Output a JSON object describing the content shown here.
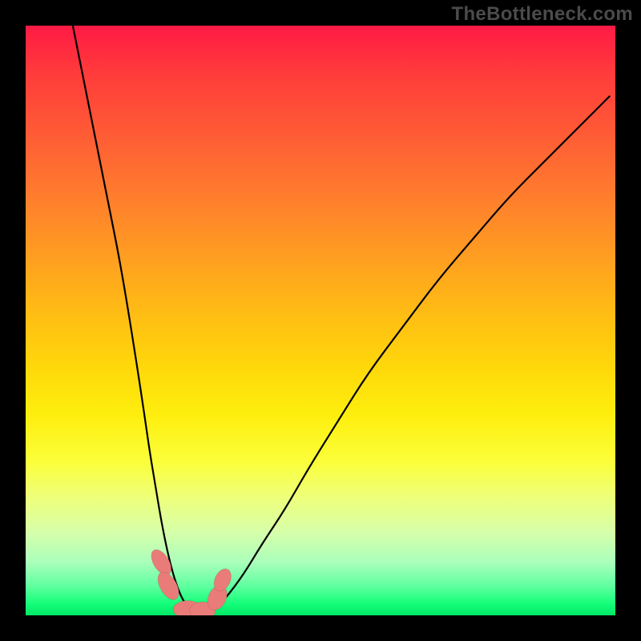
{
  "watermark_text": "TheBottleneck.com",
  "colors": {
    "frame": "#000000",
    "marker_fill": "#e97c78",
    "curve_stroke": "#000000"
  },
  "chart_data": {
    "type": "line",
    "title": "",
    "xlabel": "",
    "ylabel": "",
    "xlim": [
      0,
      100
    ],
    "ylim": [
      0,
      100
    ],
    "grid": false,
    "legend": false,
    "series": [
      {
        "name": "left-branch",
        "x": [
          8,
          10,
          12,
          14,
          16,
          18,
          20,
          21,
          22,
          23,
          24,
          25,
          26,
          27,
          28
        ],
        "values": [
          100,
          90,
          80,
          70,
          60,
          48,
          35,
          28,
          22,
          16,
          11,
          7,
          4,
          2,
          1
        ]
      },
      {
        "name": "valley-floor",
        "x": [
          28,
          29,
          30,
          31,
          32
        ],
        "values": [
          1,
          0.8,
          0.7,
          0.8,
          1
        ]
      },
      {
        "name": "right-branch",
        "x": [
          32,
          34,
          37,
          40,
          44,
          48,
          53,
          58,
          64,
          70,
          76,
          82,
          88,
          94,
          99
        ],
        "values": [
          1,
          3,
          7,
          12,
          18,
          25,
          33,
          41,
          49,
          57,
          64,
          71,
          77,
          83,
          88
        ]
      }
    ],
    "markers": [
      {
        "x": 23.0,
        "y": 9.0,
        "rx": 1.3,
        "ry": 2.4,
        "rot": -32
      },
      {
        "x": 24.2,
        "y": 5.0,
        "rx": 1.4,
        "ry": 2.6,
        "rot": -30
      },
      {
        "x": 27.5,
        "y": 1,
        "rx": 2.5,
        "ry": 1.5,
        "rot": 0
      },
      {
        "x": 30.0,
        "y": 0.8,
        "rx": 2.2,
        "ry": 1.5,
        "rot": 0
      },
      {
        "x": 32.5,
        "y": 3.0,
        "rx": 1.5,
        "ry": 2.2,
        "rot": 25
      },
      {
        "x": 33.4,
        "y": 6.0,
        "rx": 1.3,
        "ry": 2.0,
        "rot": 25
      }
    ]
  }
}
